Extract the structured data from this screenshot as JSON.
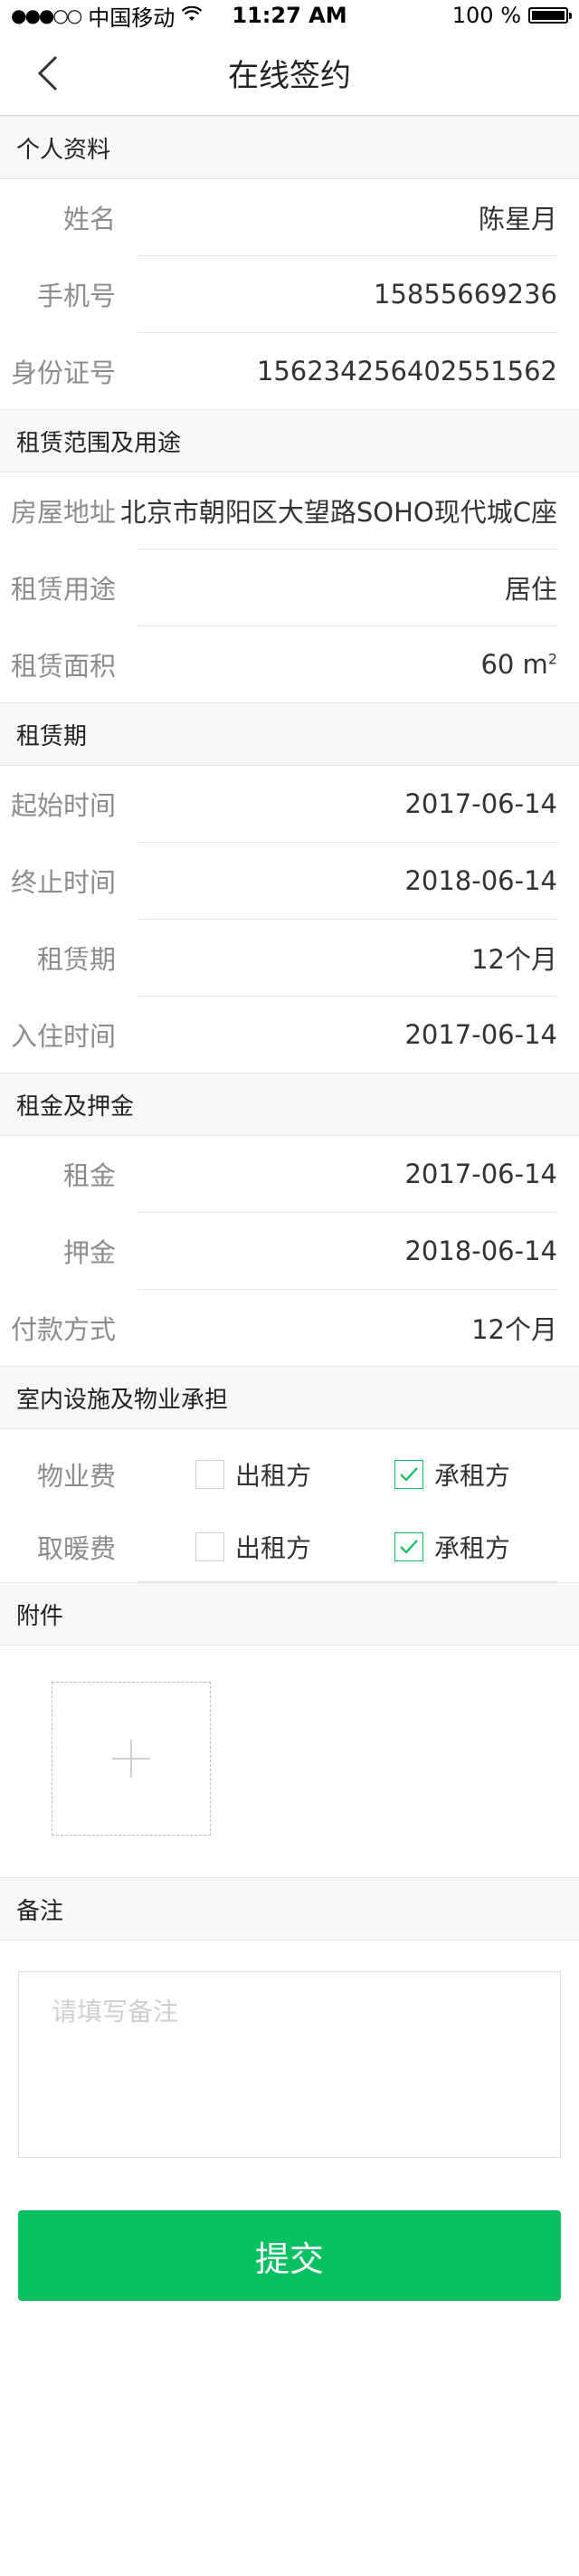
{
  "status_bar": {
    "signal": "●●●○○",
    "carrier": "中国移动",
    "time": "11:27 AM",
    "battery": "100 %"
  },
  "nav": {
    "title": "在线签约"
  },
  "sections": {
    "personal": {
      "title": "个人资料",
      "rows": [
        {
          "label": "姓名",
          "value": "陈星月"
        },
        {
          "label": "手机号",
          "value": "15855669236"
        },
        {
          "label": "身份证号",
          "value": "156234256402551562"
        }
      ]
    },
    "scope": {
      "title": "租赁范围及用途",
      "rows": [
        {
          "label": "房屋地址",
          "value": "北京市朝阳区大望路SOHO现代城C座"
        },
        {
          "label": "租赁用途",
          "value": "居住"
        },
        {
          "label": "租赁面积",
          "value": "60 m",
          "unit_sup": "2"
        }
      ]
    },
    "period": {
      "title": "租赁期",
      "rows": [
        {
          "label": "起始时间",
          "value": "2017-06-14"
        },
        {
          "label": "终止时间",
          "value": "2018-06-14"
        },
        {
          "label": "租赁期",
          "value": "12个月"
        },
        {
          "label": "入住时间",
          "value": "2017-06-14"
        }
      ]
    },
    "rent": {
      "title": "租金及押金",
      "rows": [
        {
          "label": "租金",
          "value": "2017-06-14"
        },
        {
          "label": "押金",
          "value": "2018-06-14"
        },
        {
          "label": "付款方式",
          "value": "12个月"
        }
      ]
    },
    "facilities": {
      "title": "室内设施及物业承担",
      "rows": [
        {
          "label": "物业费",
          "options": [
            {
              "label": "出租方",
              "checked": false
            },
            {
              "label": "承租方",
              "checked": true
            }
          ]
        },
        {
          "label": "取暖费",
          "options": [
            {
              "label": "出租方",
              "checked": false
            },
            {
              "label": "承租方",
              "checked": true
            }
          ]
        }
      ]
    },
    "attachments": {
      "title": "附件"
    },
    "notes": {
      "title": "备注",
      "placeholder": "请填写备注"
    }
  },
  "submit_label": "提交",
  "colors": {
    "accent": "#07c160"
  }
}
